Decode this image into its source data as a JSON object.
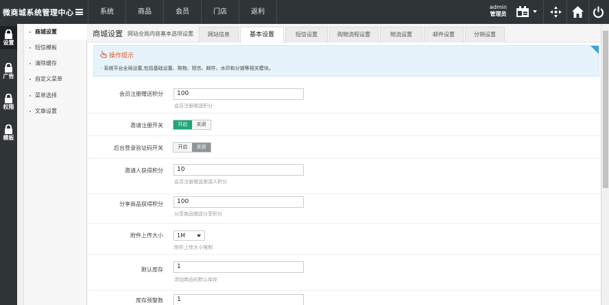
{
  "header": {
    "brand": "微商城系统管理中心",
    "nav": [
      "系统",
      "商品",
      "会员",
      "门店",
      "返利"
    ],
    "user": {
      "name": "admin",
      "role": "管理员"
    }
  },
  "rail": [
    {
      "label": "设置",
      "active": true
    },
    {
      "label": "广告",
      "active": false
    },
    {
      "label": "权限",
      "active": false
    },
    {
      "label": "模板",
      "active": false
    }
  ],
  "submenu": [
    "商城设置",
    "短信模板",
    "清除缓存",
    "自定义菜单",
    "菜单选择",
    "文章设置"
  ],
  "page": {
    "title": "商城设置",
    "subtitle": "网站全局内容基本选项设置",
    "tabs": [
      "网站信息",
      "基本设置",
      "短信设置",
      "购物流程设置",
      "物流设置",
      "邮件设置",
      "分销设置"
    ],
    "active_tab": "基本设置"
  },
  "hint": {
    "title": "操作提示",
    "text": "· 系统平台全局设置,包括基础设置、购物、短信、邮件、水印和分销等相关模块。"
  },
  "form": {
    "register_points": {
      "label": "会员注册赠送积分",
      "value": "100",
      "help": "会员注册赠送积分"
    },
    "invite_switch": {
      "label": "邀请注册开关",
      "on": "开启",
      "off": "关闭",
      "state": "on"
    },
    "captcha_switch": {
      "label": "后台登录验证码开关",
      "on": "开启",
      "off": "关闭",
      "state": "off"
    },
    "inviter_points": {
      "label": "邀请人获得积分",
      "value": "10",
      "help": "会员注册赠送邀请人积分"
    },
    "share_points": {
      "label": "分享商品获得积分",
      "value": "100",
      "help": "分享商品赠送分享积分"
    },
    "upload_size": {
      "label": "附件上传大小",
      "value": "1M",
      "help": "附件上传大小限制"
    },
    "default_stock": {
      "label": "默认库存",
      "value": "1",
      "help": "添加商品的默认库存"
    },
    "stock_warning": {
      "label": "库存预警数",
      "value": "1"
    }
  }
}
